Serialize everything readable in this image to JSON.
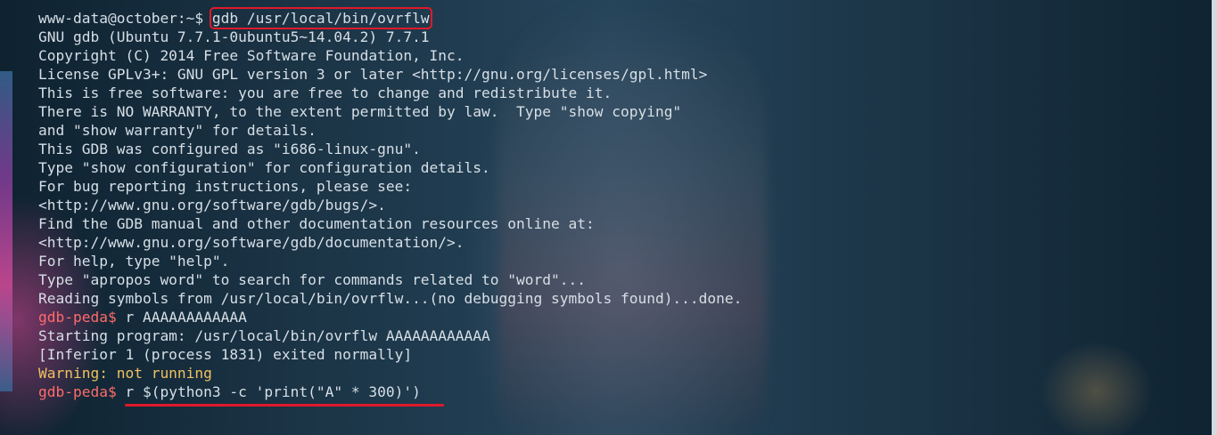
{
  "lines": [
    {
      "prompt": "www-data@october:~$ ",
      "cmd": "gdb /usr/local/bin/ovrflw"
    },
    "GNU gdb (Ubuntu 7.7.1-0ubuntu5~14.04.2) 7.7.1",
    "Copyright (C) 2014 Free Software Foundation, Inc.",
    "License GPLv3+: GNU GPL version 3 or later <http://gnu.org/licenses/gpl.html>",
    "This is free software: you are free to change and redistribute it.",
    "There is NO WARRANTY, to the extent permitted by law.  Type \"show copying\"",
    "and \"show warranty\" for details.",
    "This GDB was configured as \"i686-linux-gnu\".",
    "Type \"show configuration\" for configuration details.",
    "For bug reporting instructions, please see:",
    "<http://www.gnu.org/software/gdb/bugs/>.",
    "Find the GDB manual and other documentation resources online at:",
    "<http://www.gnu.org/software/gdb/documentation/>.",
    "For help, type \"help\".",
    "Type \"apropos word\" to search for commands related to \"word\"...",
    "Reading symbols from /usr/local/bin/ovrflw...(no debugging symbols found)...done.",
    {
      "prompt": "gdb-peda$ ",
      "cmd": "r AAAAAAAAAAAA"
    },
    "Starting program: /usr/local/bin/ovrflw AAAAAAAAAAAA",
    "[Inferior 1 (process 1831) exited normally]",
    "Warning: not running",
    {
      "prompt": "gdb-peda$ ",
      "cmd": "r $(python3 -c 'print(\"A\" * 300)')"
    }
  ],
  "colors": {
    "text": "#d7dfe6",
    "peda_prompt": "#ff6b6b",
    "warning": "#f0c060",
    "highlight": "#e0192a"
  }
}
